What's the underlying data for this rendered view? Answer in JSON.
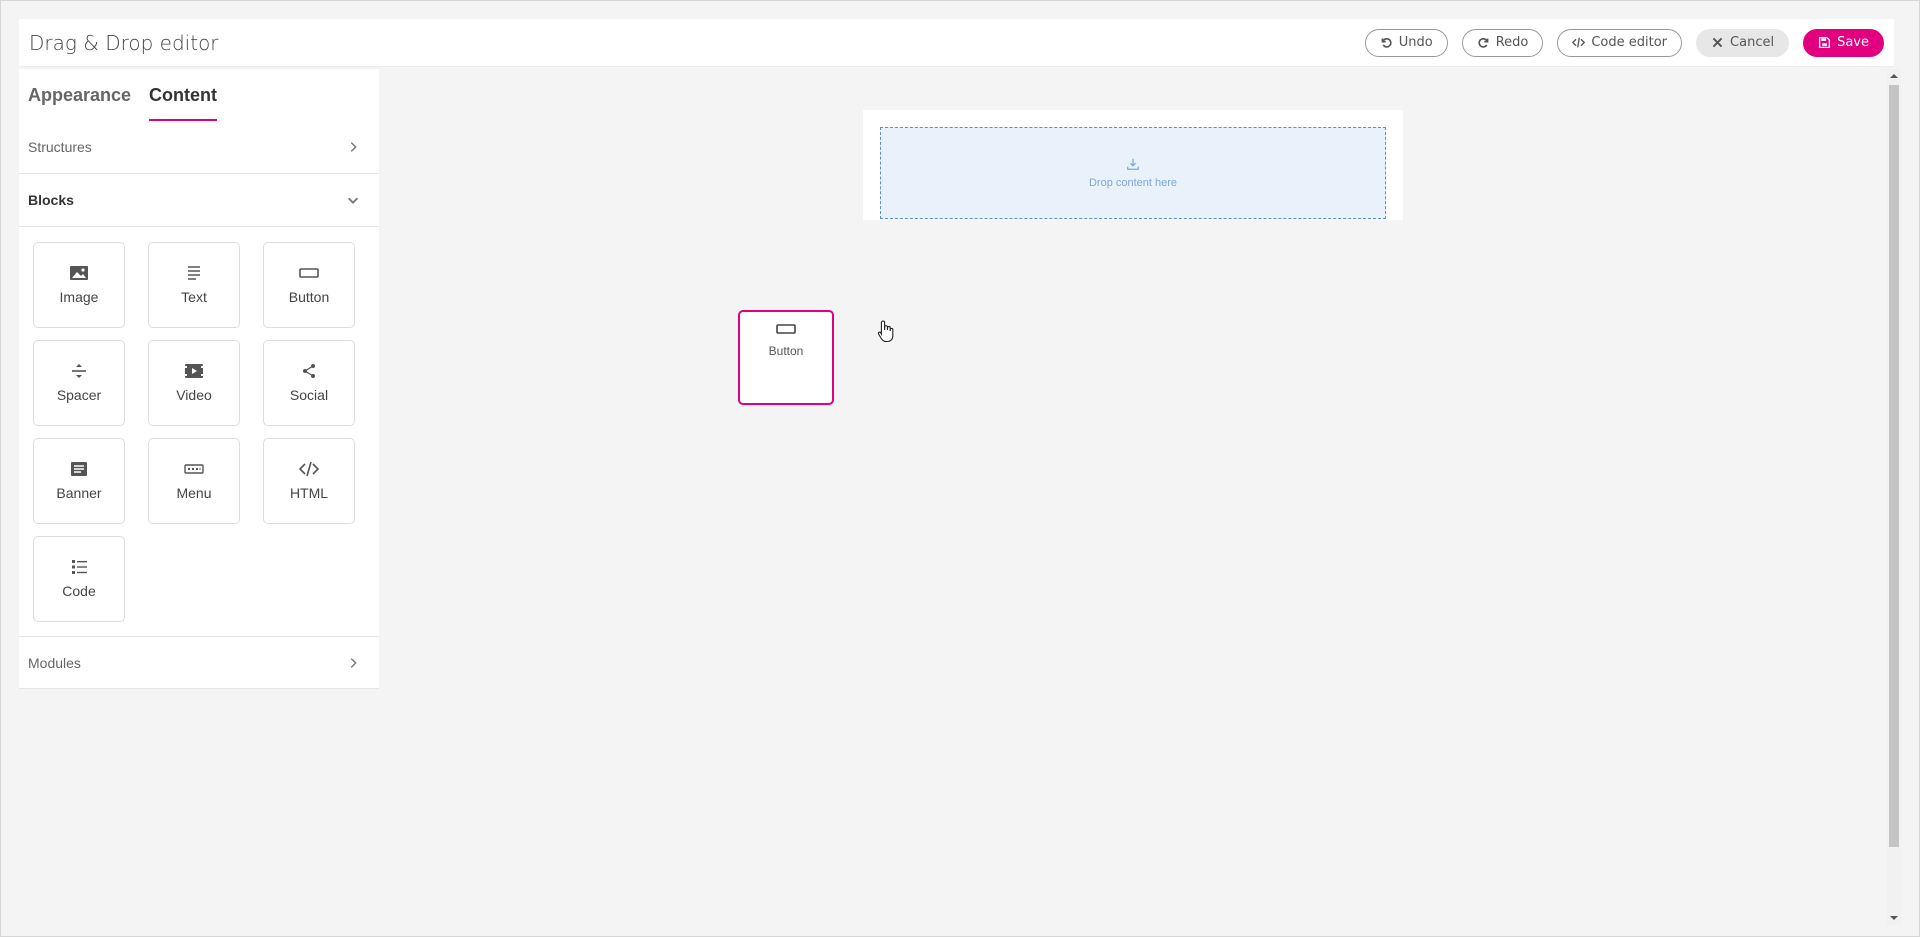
{
  "header": {
    "title": "Drag & Drop editor",
    "undo_label": "Undo",
    "redo_label": "Redo",
    "code_editor_label": "Code editor",
    "cancel_label": "Cancel",
    "save_label": "Save"
  },
  "sidebar": {
    "tabs": [
      {
        "label": "Appearance",
        "active": false
      },
      {
        "label": "Content",
        "active": true
      }
    ],
    "sections": {
      "structures": "Structures",
      "blocks": "Blocks",
      "modules": "Modules"
    },
    "blocks": [
      {
        "label": "Image",
        "icon": "image-icon"
      },
      {
        "label": "Text",
        "icon": "text-icon"
      },
      {
        "label": "Button",
        "icon": "button-icon"
      },
      {
        "label": "Spacer",
        "icon": "spacer-icon"
      },
      {
        "label": "Video",
        "icon": "video-icon"
      },
      {
        "label": "Social",
        "icon": "share-icon"
      },
      {
        "label": "Banner",
        "icon": "banner-icon"
      },
      {
        "label": "Menu",
        "icon": "menu-icon"
      },
      {
        "label": "HTML",
        "icon": "code-brackets-icon"
      },
      {
        "label": "Code",
        "icon": "list-icon"
      }
    ]
  },
  "canvas": {
    "drop_zone_text": "Drop content here",
    "dragging_block_label": "Button"
  },
  "colors": {
    "accent": "#e3007e",
    "drop_zone_bg": "#e9f1fb",
    "drop_zone_border": "#5b8fd1"
  }
}
